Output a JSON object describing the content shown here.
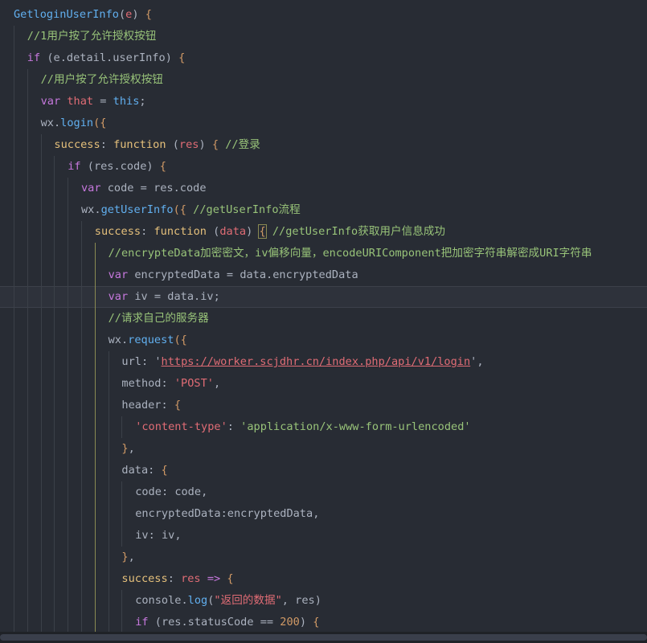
{
  "editor": {
    "theme": {
      "background": "#282c34",
      "active_line": "#2e323b"
    },
    "active_line_index": 13,
    "lines": [
      {
        "indent": 0,
        "tokens": [
          [
            "fn",
            "GetloginUserInfo"
          ],
          [
            "punc",
            "("
          ],
          [
            "var",
            "e"
          ],
          [
            "punc",
            ") "
          ],
          [
            "brace",
            "{"
          ]
        ]
      },
      {
        "indent": 1,
        "tokens": [
          [
            "cmt",
            "//1用户按了允许授权按钮"
          ]
        ]
      },
      {
        "indent": 1,
        "tokens": [
          [
            "kw",
            "if"
          ],
          [
            "punc",
            " ("
          ],
          [
            "def",
            "e.detail.userInfo"
          ],
          [
            "punc",
            ") "
          ],
          [
            "brace",
            "{"
          ]
        ]
      },
      {
        "indent": 2,
        "tokens": [
          [
            "cmt",
            "//用户按了允许授权按钮"
          ]
        ]
      },
      {
        "indent": 2,
        "tokens": [
          [
            "kw",
            "var "
          ],
          [
            "var",
            "that"
          ],
          [
            "punc",
            " = "
          ],
          [
            "this",
            "this"
          ],
          [
            "punc",
            ";"
          ]
        ]
      },
      {
        "indent": 2,
        "tokens": [
          [
            "def",
            "wx."
          ],
          [
            "fn",
            "login"
          ],
          [
            "brace",
            "({"
          ]
        ]
      },
      {
        "indent": 3,
        "tokens": [
          [
            "prop",
            "success"
          ],
          [
            "punc",
            ": "
          ],
          [
            "kw2",
            "function"
          ],
          [
            "punc",
            " ("
          ],
          [
            "var",
            "res"
          ],
          [
            "punc",
            ") "
          ],
          [
            "brace",
            "{"
          ],
          [
            "punc",
            " "
          ],
          [
            "cmt",
            "//登录"
          ]
        ]
      },
      {
        "indent": 4,
        "tokens": [
          [
            "kw",
            "if"
          ],
          [
            "punc",
            " ("
          ],
          [
            "def",
            "res.code"
          ],
          [
            "punc",
            ") "
          ],
          [
            "brace",
            "{"
          ]
        ]
      },
      {
        "indent": 5,
        "tokens": [
          [
            "kw",
            "var "
          ],
          [
            "def",
            "code"
          ],
          [
            "punc",
            " = "
          ],
          [
            "def",
            "res.code"
          ]
        ]
      },
      {
        "indent": 5,
        "tokens": [
          [
            "def",
            "wx."
          ],
          [
            "fn",
            "getUserInfo"
          ],
          [
            "brace",
            "({"
          ],
          [
            "punc",
            " "
          ],
          [
            "cmt",
            "//getUserInfo流程"
          ]
        ]
      },
      {
        "indent": 6,
        "tokens": [
          [
            "prop",
            "success"
          ],
          [
            "punc",
            ": "
          ],
          [
            "kw2",
            "function"
          ],
          [
            "punc",
            " ("
          ],
          [
            "var",
            "data"
          ],
          [
            "punc",
            ") "
          ],
          [
            "bmbrace",
            "{"
          ],
          [
            "punc",
            " "
          ],
          [
            "cmt",
            "//getUserInfo获取用户信息成功"
          ]
        ]
      },
      {
        "indent": 7,
        "tokens": [
          [
            "cmt",
            "//encrypteData加密密文，iv偏移向量，encodeURIComponent把加密字符串解密成URI字符串"
          ]
        ]
      },
      {
        "indent": 7,
        "tokens": [
          [
            "kw",
            "var "
          ],
          [
            "def",
            "encryptedData"
          ],
          [
            "punc",
            " = "
          ],
          [
            "def",
            "data.encryptedData"
          ]
        ]
      },
      {
        "indent": 7,
        "tokens": [
          [
            "kw",
            "var "
          ],
          [
            "def",
            "iv"
          ],
          [
            "punc",
            " = "
          ],
          [
            "def",
            "data.iv"
          ],
          [
            "punc",
            ";"
          ]
        ]
      },
      {
        "indent": 7,
        "tokens": [
          [
            "cmt",
            "//请求自己的服务器"
          ]
        ]
      },
      {
        "indent": 7,
        "tokens": [
          [
            "def",
            "wx."
          ],
          [
            "fn",
            "request"
          ],
          [
            "brace",
            "({"
          ]
        ]
      },
      {
        "indent": 8,
        "tokens": [
          [
            "def",
            "url"
          ],
          [
            "punc",
            ": '"
          ],
          [
            "url",
            "https://worker.scjdhr.cn/index.php/api/v1/login"
          ],
          [
            "punc",
            "',"
          ]
        ]
      },
      {
        "indent": 8,
        "tokens": [
          [
            "def",
            "method"
          ],
          [
            "punc",
            ": "
          ],
          [
            "strr",
            "'POST'"
          ],
          [
            "punc",
            ","
          ]
        ]
      },
      {
        "indent": 8,
        "tokens": [
          [
            "def",
            "header"
          ],
          [
            "punc",
            ": "
          ],
          [
            "brace",
            "{"
          ]
        ]
      },
      {
        "indent": 9,
        "tokens": [
          [
            "strr",
            "'content-type'"
          ],
          [
            "punc",
            ": "
          ],
          [
            "str",
            "'application/x-www-form-urlencoded'"
          ]
        ]
      },
      {
        "indent": 8,
        "tokens": [
          [
            "brace",
            "}"
          ],
          [
            "punc",
            ","
          ]
        ]
      },
      {
        "indent": 8,
        "tokens": [
          [
            "def",
            "data"
          ],
          [
            "punc",
            ": "
          ],
          [
            "brace",
            "{"
          ]
        ]
      },
      {
        "indent": 9,
        "tokens": [
          [
            "def",
            "code"
          ],
          [
            "punc",
            ": "
          ],
          [
            "def",
            "code"
          ],
          [
            "punc",
            ","
          ]
        ]
      },
      {
        "indent": 9,
        "tokens": [
          [
            "def",
            "encryptedData"
          ],
          [
            "punc",
            ":"
          ],
          [
            "def",
            "encryptedData"
          ],
          [
            "punc",
            ","
          ]
        ]
      },
      {
        "indent": 9,
        "tokens": [
          [
            "def",
            "iv"
          ],
          [
            "punc",
            ": "
          ],
          [
            "def",
            "iv"
          ],
          [
            "punc",
            ","
          ]
        ]
      },
      {
        "indent": 8,
        "tokens": [
          [
            "brace",
            "}"
          ],
          [
            "punc",
            ","
          ]
        ]
      },
      {
        "indent": 8,
        "tokens": [
          [
            "prop",
            "success"
          ],
          [
            "punc",
            ": "
          ],
          [
            "var",
            "res"
          ],
          [
            "punc",
            " "
          ],
          [
            "kw",
            "=>"
          ],
          [
            "punc",
            " "
          ],
          [
            "brace",
            "{"
          ]
        ]
      },
      {
        "indent": 9,
        "tokens": [
          [
            "def",
            "console."
          ],
          [
            "fn",
            "log"
          ],
          [
            "punc",
            "("
          ],
          [
            "strr",
            "\"返回的数据\""
          ],
          [
            "punc",
            ", "
          ],
          [
            "def",
            "res"
          ],
          [
            "punc",
            ")"
          ]
        ]
      },
      {
        "indent": 9,
        "tokens": [
          [
            "kw",
            "if"
          ],
          [
            "punc",
            " ("
          ],
          [
            "def",
            "res.statusCode"
          ],
          [
            "punc",
            " == "
          ],
          [
            "num",
            "200"
          ],
          [
            "punc",
            ") "
          ],
          [
            "brace",
            "{"
          ]
        ]
      }
    ]
  }
}
